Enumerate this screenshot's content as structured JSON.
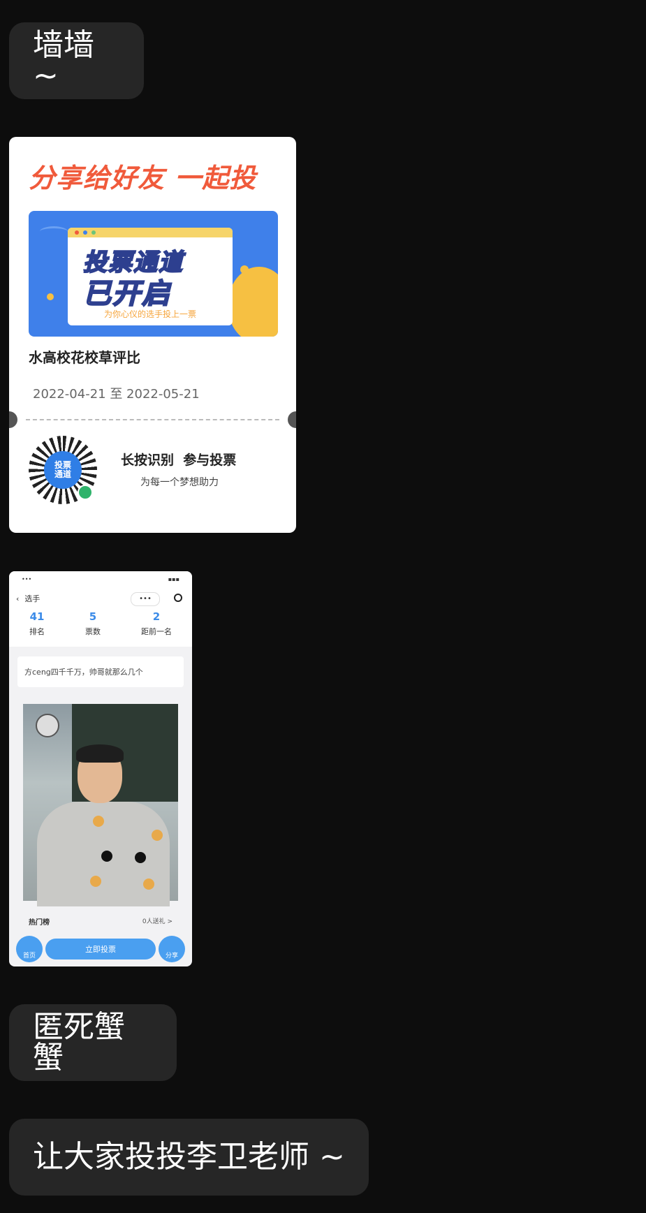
{
  "messages": {
    "m1": "墙墙 ~",
    "m2": "匿死蟹蟹",
    "m3": "让大家投投李卫老师 ~"
  },
  "poster": {
    "headline": "分享给好友 一起投",
    "banner_line1": "投票通道",
    "banner_line2": "已开启",
    "banner_sub": "为你心仪的选手投上一票",
    "title": "水高校花校草评比",
    "dates": "2022-04-21 至 2022-05-21",
    "qr_center": "投票\n通道",
    "cta": "长按识别  参与投票",
    "sub": "为每一个梦想助力",
    "colors": {
      "headline": "#f05a3b",
      "banner": "#3f80ea",
      "accent": "#f6c042"
    }
  },
  "screenshot": {
    "nav_title": "选手",
    "nav_more": "•••",
    "stats": [
      {
        "value": "41",
        "label": "排名"
      },
      {
        "value": "5",
        "label": "票数"
      },
      {
        "value": "2",
        "label": "距前一名"
      }
    ],
    "message": "方ceng四千千万，帅哥就那么几个",
    "hot_label": "热门榜",
    "more_label": "0人送礼 >",
    "home_label": "首页",
    "vote_label": "立即投票",
    "share_label": "分享",
    "accent": "#4a9ff0"
  }
}
